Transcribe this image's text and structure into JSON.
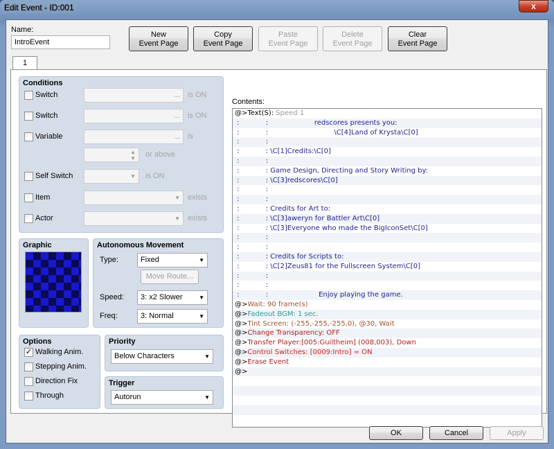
{
  "window": {
    "title": "Edit Event - ID:001",
    "close_glyph": "x"
  },
  "name": {
    "label": "Name:",
    "value": "IntroEvent"
  },
  "toolbar": [
    {
      "label": "New\nEvent Page",
      "enabled": true
    },
    {
      "label": "Copy\nEvent Page",
      "enabled": true
    },
    {
      "label": "Paste\nEvent Page",
      "enabled": false
    },
    {
      "label": "Delete\nEvent Page",
      "enabled": false
    },
    {
      "label": "Clear\nEvent Page",
      "enabled": true
    }
  ],
  "tab": {
    "label": "1"
  },
  "conditions": {
    "title": "Conditions",
    "switch1": {
      "label": "Switch",
      "suffix": "is ON"
    },
    "switch2": {
      "label": "Switch",
      "suffix": "is ON"
    },
    "variable": {
      "label": "Variable",
      "suffix": "is",
      "suffix2": "or above"
    },
    "self_switch": {
      "label": "Self Switch",
      "suffix": "is ON"
    },
    "item": {
      "label": "Item",
      "suffix": "exists"
    },
    "actor": {
      "label": "Actor",
      "suffix": "exists"
    }
  },
  "graphic": {
    "title": "Graphic"
  },
  "autonomous": {
    "title": "Autonomous Movement",
    "type_label": "Type:",
    "type_value": "Fixed",
    "move_route": "Move Route...",
    "speed_label": "Speed:",
    "speed_value": "3: x2 Slower",
    "freq_label": "Freq:",
    "freq_value": "3: Normal"
  },
  "options": {
    "title": "Options",
    "items": [
      {
        "label": "Walking Anim.",
        "checked": true
      },
      {
        "label": "Stepping Anim.",
        "checked": false
      },
      {
        "label": "Direction Fix",
        "checked": false
      },
      {
        "label": "Through",
        "checked": false
      }
    ]
  },
  "priority": {
    "title": "Priority",
    "value": "Below Characters"
  },
  "trigger": {
    "title": "Trigger",
    "value": "Autorun"
  },
  "contents": {
    "label": "Contents:",
    "lines": [
      {
        "text": "@>Text(S):",
        "extra": " Speed 1",
        "color": "#000",
        "extra_color": "#9a9a9a"
      },
      {
        "text": " :            :                     redscores presents you:",
        "color": "#1f1f8f"
      },
      {
        "text": " :            :                              \\C[4]Land of Krysta\\C[0]",
        "color": "#1f1f8f"
      },
      {
        "text": " :            :",
        "color": "#1f1f8f"
      },
      {
        "text": " :            : \\C[1]Credits:\\C[0]",
        "color": "#1f1f8f"
      },
      {
        "text": " :            :",
        "color": "#1f1f8f"
      },
      {
        "text": " :            : Game Design, Directing and Story Writing by:",
        "color": "#1f1f8f"
      },
      {
        "text": " :            : \\C[3]redscores\\C[0]",
        "color": "#1f1f8f"
      },
      {
        "text": " :            :",
        "color": "#1f1f8f"
      },
      {
        "text": " :            :",
        "color": "#1f1f8f"
      },
      {
        "text": " :            : Credits for Art to:",
        "color": "#1f1f8f"
      },
      {
        "text": " :            : \\C[3]aweryn for Battler Art\\C[0]",
        "color": "#1f1f8f"
      },
      {
        "text": " :            : \\C[3]Everyone who made the BigIconSet\\C[0]",
        "color": "#1f1f8f"
      },
      {
        "text": " :            :",
        "color": "#1f1f8f"
      },
      {
        "text": " :            :",
        "color": "#1f1f8f"
      },
      {
        "text": " :            : Credits for Scripts to:",
        "color": "#1f1f8f"
      },
      {
        "text": " :            : \\C[2]Zeus81 for the Fullscreen System\\C[0]",
        "color": "#1f1f8f"
      },
      {
        "text": " :            :",
        "color": "#1f1f8f"
      },
      {
        "text": " :            :",
        "color": "#1f1f8f"
      },
      {
        "text": " :            :                       Enjoy playing the game.",
        "color": "#1f1f8f"
      },
      {
        "text": "@>",
        "extra": "Wait: 90 frame(s)",
        "color": "#000",
        "extra_color": "#a0522d"
      },
      {
        "text": "@>",
        "extra": "Fadeout BGM: 1 sec.",
        "color": "#000",
        "extra_color": "#2a9d9d"
      },
      {
        "text": "@>",
        "extra": "Tint Screen: (-255,-255,-255,0), @30, Wait",
        "color": "#000",
        "extra_color": "#a0522d"
      },
      {
        "text": "@>",
        "extra": "Change Transparency: OFF",
        "color": "#000",
        "extra_color": "#b02020"
      },
      {
        "text": "@>",
        "extra": "Transfer Player:[005:Guiltheim] (008,003), Down",
        "color": "#000",
        "extra_color": "#b02020"
      },
      {
        "text": "@>",
        "extra": "Control Switches: [0009:Intro] = ON",
        "color": "#000",
        "extra_color": "#d02020"
      },
      {
        "text": "@>",
        "extra": "Erase Event",
        "color": "#000",
        "extra_color": "#b02020"
      },
      {
        "text": "@>",
        "color": "#000"
      }
    ]
  },
  "footer": {
    "ok": "OK",
    "cancel": "Cancel",
    "apply": "Apply"
  }
}
